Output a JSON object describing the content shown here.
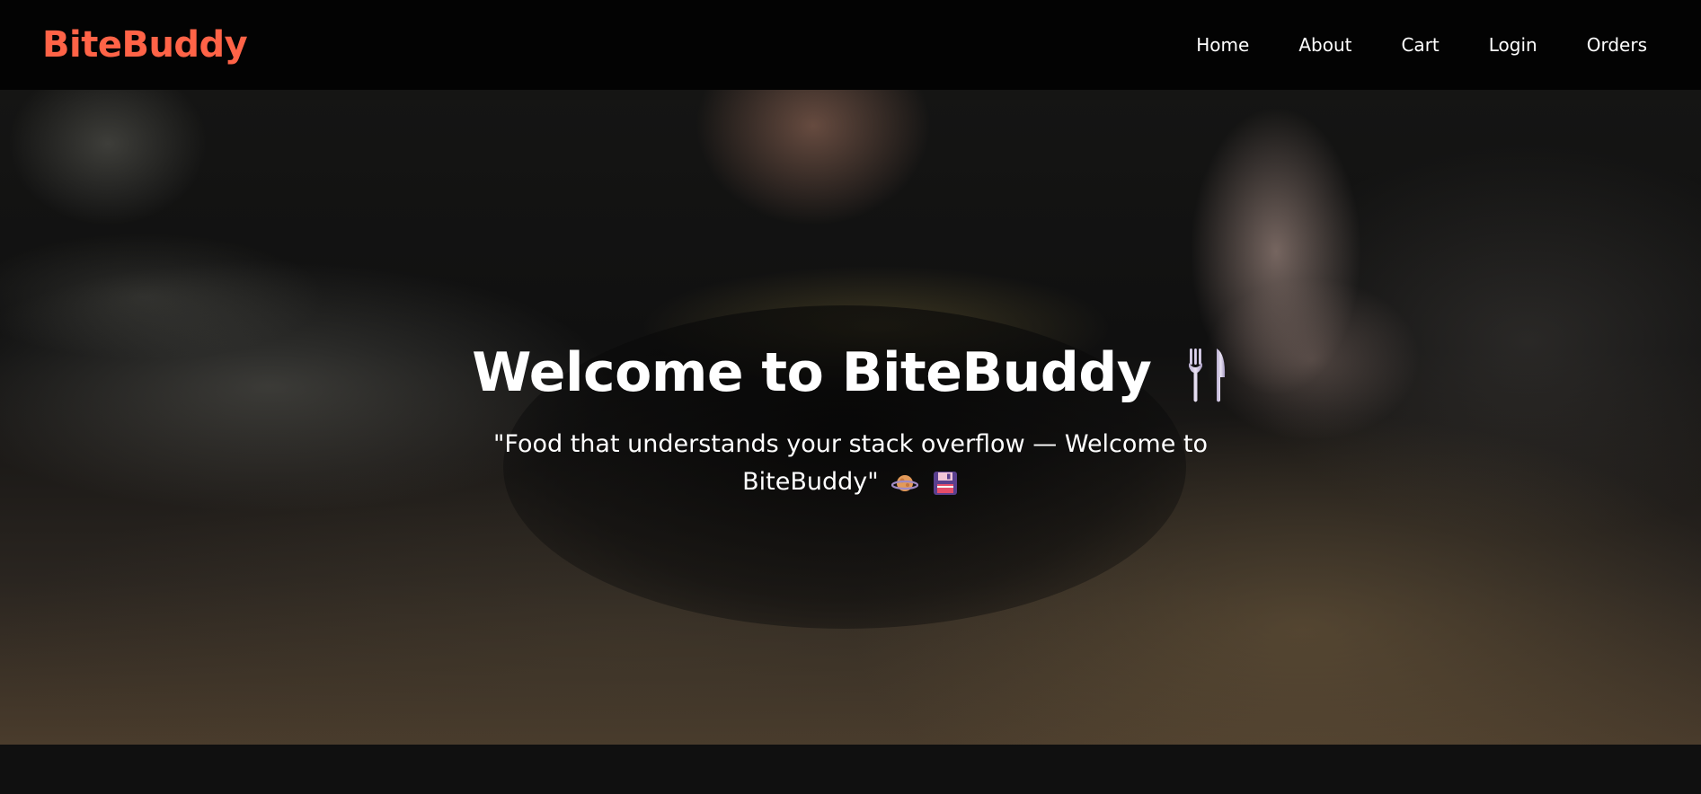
{
  "brand": {
    "name": "BiteBuddy",
    "color": "#ff6347"
  },
  "nav": {
    "items": [
      {
        "label": "Home"
      },
      {
        "label": "About"
      },
      {
        "label": "Cart"
      },
      {
        "label": "Login"
      },
      {
        "label": "Orders"
      }
    ]
  },
  "hero": {
    "title": "Welcome to BiteBuddy",
    "title_icon": "fork-and-knife-icon",
    "tagline": "\"Food that understands your stack overflow — Welcome to BiteBuddy\"",
    "tagline_icons": [
      "ringed-planet-icon",
      "floppy-disk-icon"
    ]
  },
  "colors": {
    "navbar_bg": "#030303",
    "text": "#ffffff",
    "page_bg": "#101010"
  }
}
